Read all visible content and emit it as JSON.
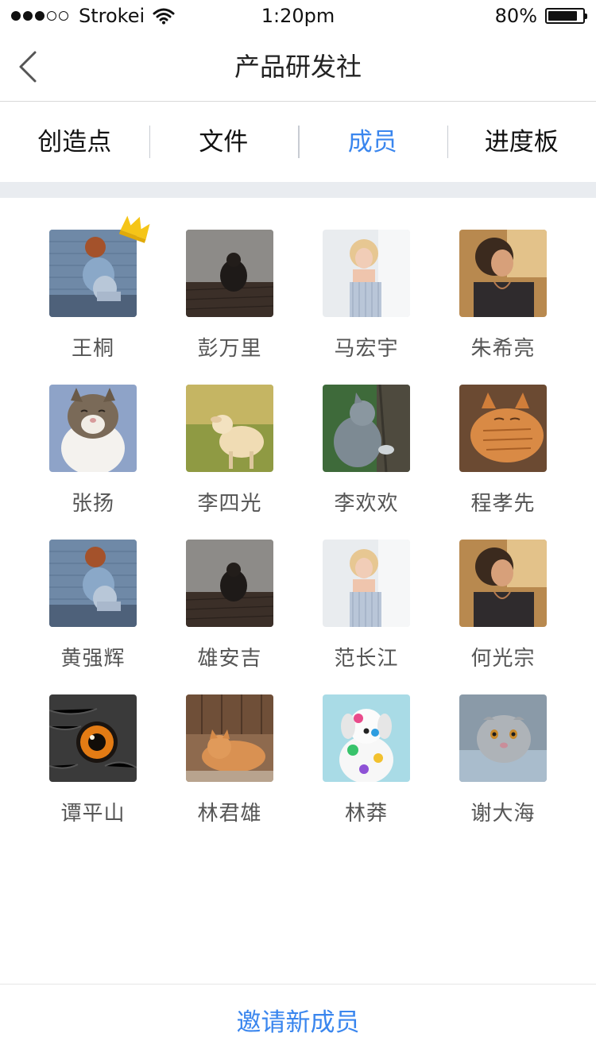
{
  "status_bar": {
    "carrier": "Strokei",
    "time": "1:20pm",
    "battery": "80%",
    "signal_icon": "signal-dots-icon",
    "wifi_icon": "wifi-icon",
    "battery_icon": "battery-icon"
  },
  "nav": {
    "title": "产品研发社",
    "back_icon": "chevron-left-icon"
  },
  "tabs": [
    {
      "label": "创造点",
      "active": false
    },
    {
      "label": "文件",
      "active": false
    },
    {
      "label": "成员",
      "active": true
    },
    {
      "label": "进度板",
      "active": false
    }
  ],
  "members": [
    {
      "name": "王桐",
      "avatar": "girl-sitting-window",
      "owner": true
    },
    {
      "name": "彭万里",
      "avatar": "girl-crouching-dark"
    },
    {
      "name": "马宏宇",
      "avatar": "blonde-woman"
    },
    {
      "name": "朱希亮",
      "avatar": "smiling-woman"
    },
    {
      "name": "张扬",
      "avatar": "cat-face-up"
    },
    {
      "name": "李四光",
      "avatar": "lamb-field"
    },
    {
      "name": "李欢欢",
      "avatar": "grey-cat-tree"
    },
    {
      "name": "程孝先",
      "avatar": "orange-cat-sleeping"
    },
    {
      "name": "黄强辉",
      "avatar": "girl-sitting-window"
    },
    {
      "name": "雄安吉",
      "avatar": "girl-crouching-dark"
    },
    {
      "name": "范长江",
      "avatar": "blonde-woman"
    },
    {
      "name": "何光宗",
      "avatar": "smiling-woman"
    },
    {
      "name": "谭平山",
      "avatar": "owl-eye"
    },
    {
      "name": "林君雄",
      "avatar": "orange-cat-basket"
    },
    {
      "name": "林莽",
      "avatar": "painted-dog"
    },
    {
      "name": "谢大海",
      "avatar": "scottish-fold-cat"
    }
  ],
  "invite_button": "邀请新成员",
  "colors": {
    "accent": "#3a86ee",
    "separator": "#e9ecf0",
    "crown": "#f5c518"
  }
}
